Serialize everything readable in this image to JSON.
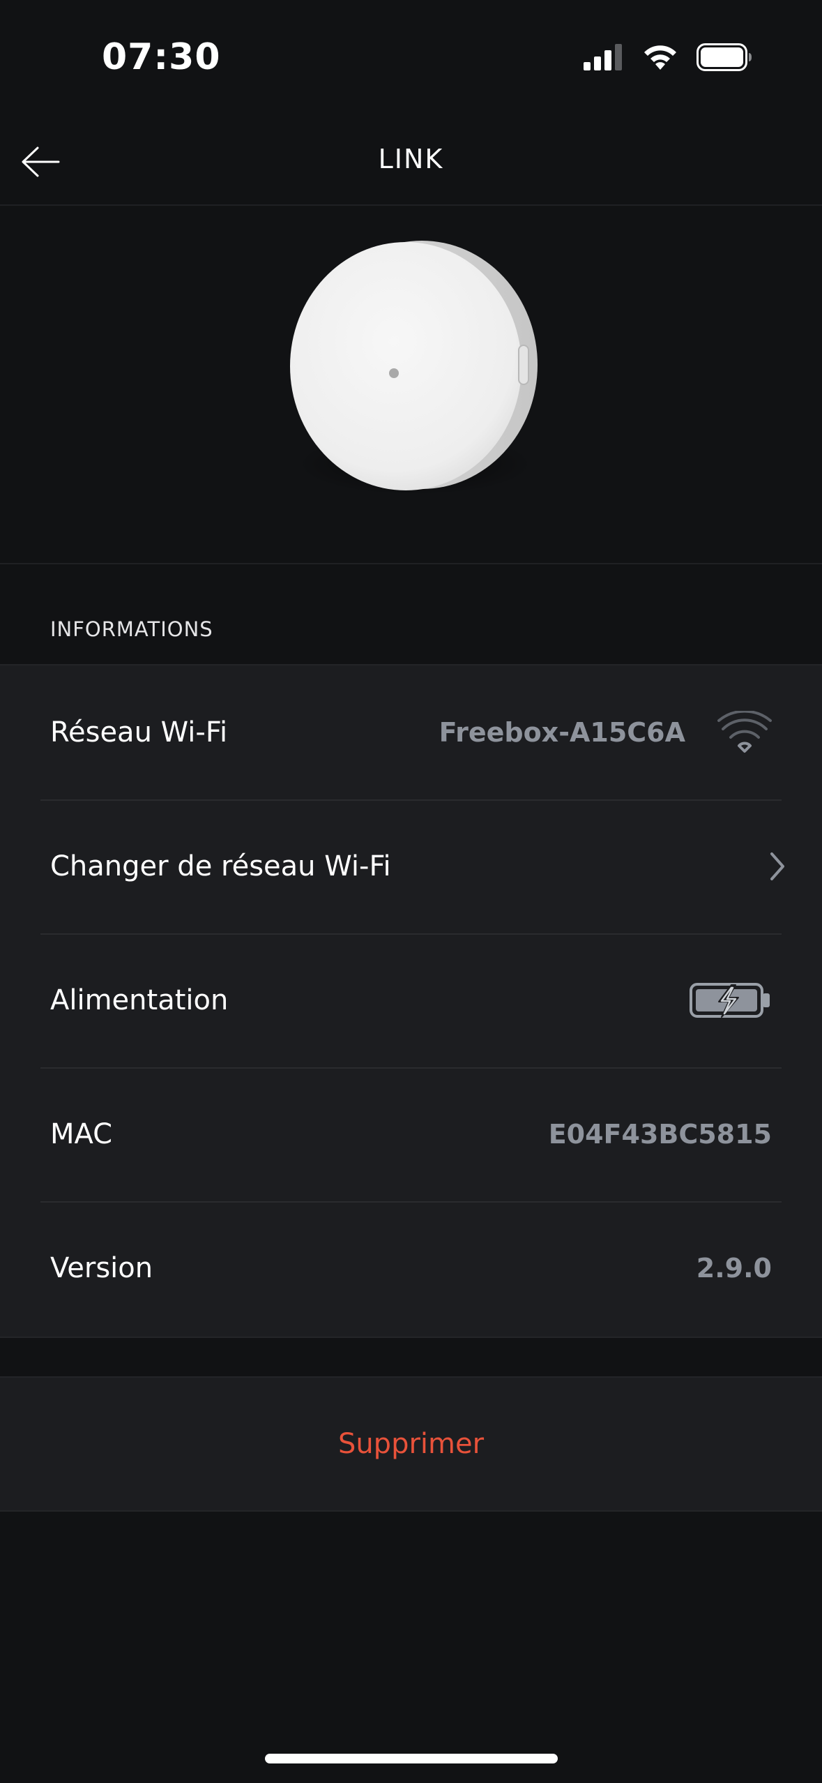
{
  "status_bar": {
    "time": "07:30",
    "icons": [
      "cellular-signal-icon",
      "wifi-icon",
      "battery-icon"
    ]
  },
  "nav": {
    "back_icon": "arrow-left-icon",
    "title": "LINK"
  },
  "device": {
    "image": "link-device-image"
  },
  "informations": {
    "header": "INFORMATIONS",
    "rows": [
      {
        "label": "Réseau Wi-Fi",
        "value": "Freebox-A15C6A",
        "icon": "wifi-signal-icon"
      },
      {
        "label": "Changer de réseau Wi-Fi",
        "value": "",
        "icon": "chevron-right-icon"
      },
      {
        "label": "Alimentation",
        "value": "",
        "icon": "battery-charging-icon"
      },
      {
        "label": "MAC",
        "value": "E04F43BC5815"
      },
      {
        "label": "Version",
        "value": "2.9.0"
      }
    ]
  },
  "actions": {
    "delete_label": "Supprimer"
  },
  "colors": {
    "background": "#111214",
    "card": "#1c1d20",
    "value_text": "#8e939c",
    "danger": "#e8523a"
  }
}
